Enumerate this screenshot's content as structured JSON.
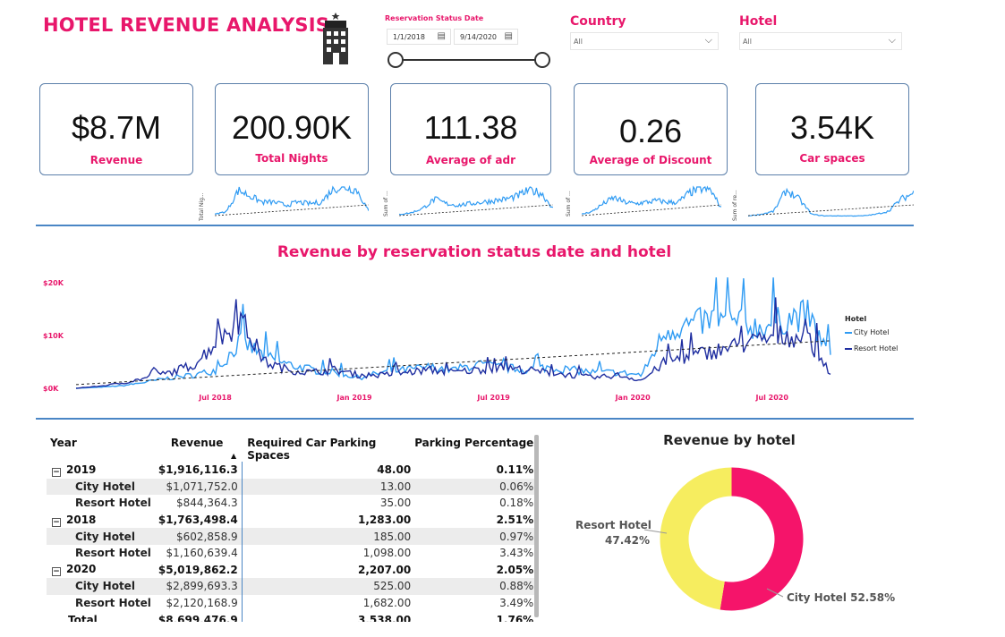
{
  "header": {
    "title": "HOTEL REVENUE ANALYSIS",
    "icon": "hotel-building-icon"
  },
  "filters": {
    "date": {
      "label": "Reservation Status Date",
      "start": "1/1/2018",
      "end": "9/14/2020"
    },
    "country": {
      "label": "Country",
      "value": "All"
    },
    "hotel": {
      "label": "Hotel",
      "value": "All"
    }
  },
  "kpis": [
    {
      "value": "$8.7M",
      "caption": "Revenue"
    },
    {
      "value": "200.90K",
      "caption": "Total Nights"
    },
    {
      "value": "111.38",
      "caption": "Average of adr"
    },
    {
      "value": "0.26",
      "caption": "Average of Discount"
    },
    {
      "value": "3.54K",
      "caption": "Car spaces"
    }
  ],
  "sparklines": [
    {
      "axis_label": "Total Nig..."
    },
    {
      "axis_label": "Sum of ..."
    },
    {
      "axis_label": "Sum of ..."
    },
    {
      "axis_label": "Sum of re..."
    }
  ],
  "colors": {
    "accent": "#e8176b",
    "city": "#2f9bf3",
    "resort": "#1f2ea0",
    "donut_city": "#f5146a",
    "donut_resort": "#f6ed5f",
    "rule": "#4a86c5"
  },
  "chart_data": [
    {
      "type": "line",
      "title": "Revenue by reservation status date and hotel",
      "xlabel": "",
      "ylabel": "",
      "x_ticks": [
        "Jul 2018",
        "Jan 2019",
        "Jul 2019",
        "Jan 2020",
        "Jul 2020"
      ],
      "y_ticks": [
        "$0K",
        "$10K",
        "$20K"
      ],
      "ylim": [
        0,
        20000
      ],
      "legend": {
        "title": "Hotel",
        "position": "right"
      },
      "trendline": true,
      "x": [
        "2018-01",
        "2018-02",
        "2018-03",
        "2018-04",
        "2018-05",
        "2018-06",
        "2018-07",
        "2018-08",
        "2018-09",
        "2018-10",
        "2018-11",
        "2018-12",
        "2019-01",
        "2019-02",
        "2019-03",
        "2019-04",
        "2019-05",
        "2019-06",
        "2019-07",
        "2019-08",
        "2019-09",
        "2019-10",
        "2019-11",
        "2019-12",
        "2020-01",
        "2020-02",
        "2020-03",
        "2020-04",
        "2020-05",
        "2020-06",
        "2020-07",
        "2020-08",
        "2020-09"
      ],
      "series": [
        {
          "name": "City Hotel",
          "values": [
            0,
            200,
            500,
            1200,
            2000,
            2500,
            3500,
            9000,
            6000,
            4500,
            3500,
            3000,
            2000,
            3000,
            3500,
            4000,
            3500,
            4500,
            4000,
            3500,
            4000,
            3500,
            3000,
            3000,
            2500,
            11000,
            12000,
            13000,
            12500,
            11500,
            13000,
            14000,
            6000
          ]
        },
        {
          "name": "Resort Hotel",
          "values": [
            0,
            400,
            1000,
            2000,
            3000,
            4500,
            9000,
            13000,
            5000,
            3500,
            3000,
            3500,
            2500,
            2500,
            3000,
            3500,
            3000,
            3500,
            4000,
            3500,
            3000,
            2500,
            2000,
            2500,
            1500,
            5000,
            6000,
            7000,
            8000,
            9000,
            10000,
            9500,
            3000
          ]
        }
      ]
    },
    {
      "type": "pie",
      "title": "Revenue by hotel",
      "categories": [
        "City Hotel",
        "Resort Hotel"
      ],
      "values": [
        52.58,
        47.42
      ],
      "labels": [
        "City Hotel 52.58%",
        "Resort Hotel",
        "47.42%"
      ]
    }
  ],
  "table": {
    "headers": [
      "Year",
      "Revenue",
      "Required Car Parking Spaces",
      "Parking Percentage"
    ],
    "rows": [
      {
        "label": "2019",
        "revenue": "$1,916,116.3",
        "parking": "48.00",
        "pct": "0.11%",
        "kind": "year"
      },
      {
        "label": "City Hotel",
        "revenue": "$1,071,752.0",
        "parking": "13.00",
        "pct": "0.06%",
        "kind": "sub"
      },
      {
        "label": "Resort Hotel",
        "revenue": "$844,364.3",
        "parking": "35.00",
        "pct": "0.18%",
        "kind": "sub"
      },
      {
        "label": "2018",
        "revenue": "$1,763,498.4",
        "parking": "1,283.00",
        "pct": "2.51%",
        "kind": "year"
      },
      {
        "label": "City Hotel",
        "revenue": "$602,858.9",
        "parking": "185.00",
        "pct": "0.97%",
        "kind": "sub"
      },
      {
        "label": "Resort Hotel",
        "revenue": "$1,160,639.4",
        "parking": "1,098.00",
        "pct": "3.43%",
        "kind": "sub"
      },
      {
        "label": "2020",
        "revenue": "$5,019,862.2",
        "parking": "2,207.00",
        "pct": "2.05%",
        "kind": "year"
      },
      {
        "label": "City Hotel",
        "revenue": "$2,899,693.3",
        "parking": "525.00",
        "pct": "0.88%",
        "kind": "sub"
      },
      {
        "label": "Resort Hotel",
        "revenue": "$2,120,168.9",
        "parking": "1,682.00",
        "pct": "3.49%",
        "kind": "sub"
      }
    ],
    "total": {
      "label": "Total",
      "revenue": "$8,699,476.9",
      "parking": "3,538.00",
      "pct": "1.76%"
    }
  }
}
